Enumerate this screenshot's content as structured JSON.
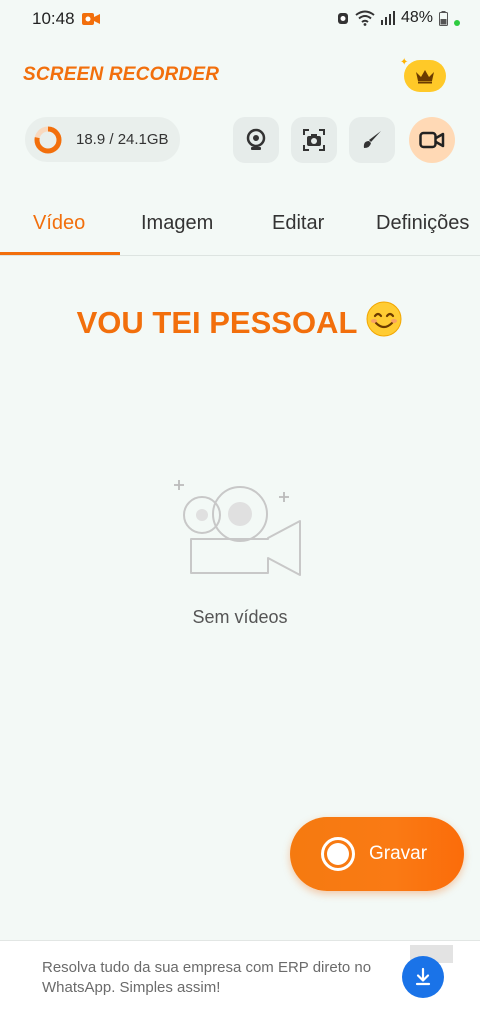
{
  "status_bar": {
    "time": "10:48",
    "battery": "48%",
    "icons": [
      "screen-record-icon",
      "alarm-icon",
      "wifi-icon",
      "signal-icon",
      "battery-icon"
    ]
  },
  "header": {
    "app_title": "SCREEN RECORDER",
    "premium_icon": "crown-icon"
  },
  "storage": {
    "text": "18.9 / 24.1GB",
    "used_fraction": 0.78
  },
  "tools": [
    {
      "name": "webcam",
      "icon": "webcam-icon"
    },
    {
      "name": "screenshot",
      "icon": "camera-capture-icon"
    },
    {
      "name": "brush",
      "icon": "brush-icon"
    },
    {
      "name": "video",
      "icon": "video-camera-icon",
      "active": true
    }
  ],
  "tabs": [
    {
      "label": "Vídeo",
      "active": true
    },
    {
      "label": "Imagem"
    },
    {
      "label": "Editar"
    },
    {
      "label": "Definições"
    }
  ],
  "headline": {
    "text": "VOU TEI PESSOAL",
    "emoji": "😊"
  },
  "empty_state": {
    "text": "Sem vídeos"
  },
  "fab": {
    "label": "Gravar"
  },
  "ad": {
    "text": "Resolva tudo da sua empresa com ERP direto no WhatsApp. Simples assim!"
  },
  "colors": {
    "accent": "#f26f0c",
    "background": "#f3f9f6",
    "ad_button": "#1a73e8"
  }
}
